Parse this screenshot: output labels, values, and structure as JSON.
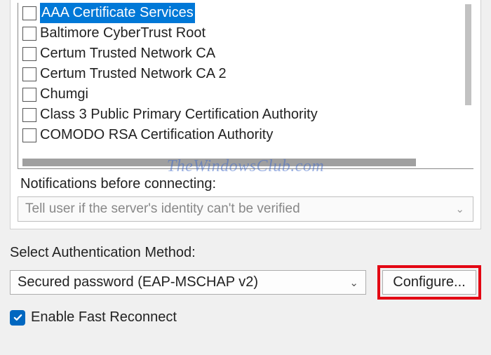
{
  "certificates": {
    "items": [
      {
        "label": "AAA Certificate Services",
        "selected": true
      },
      {
        "label": "Baltimore CyberTrust Root",
        "selected": false
      },
      {
        "label": "Certum Trusted Network CA",
        "selected": false
      },
      {
        "label": "Certum Trusted Network CA 2",
        "selected": false
      },
      {
        "label": "Chumgi",
        "selected": false
      },
      {
        "label": "Class 3 Public Primary Certification Authority",
        "selected": false
      },
      {
        "label": "COMODO RSA Certification Authority",
        "selected": false
      }
    ]
  },
  "notifications": {
    "label": "Notifications before connecting:",
    "selected": "Tell user if the server's identity can't be verified"
  },
  "auth": {
    "label": "Select Authentication Method:",
    "selected": "Secured password (EAP-MSCHAP v2)",
    "config_button": "Configure..."
  },
  "fast_reconnect": {
    "label": "Enable Fast Reconnect",
    "checked": true
  },
  "watermark": "TheWindowsClub.com"
}
